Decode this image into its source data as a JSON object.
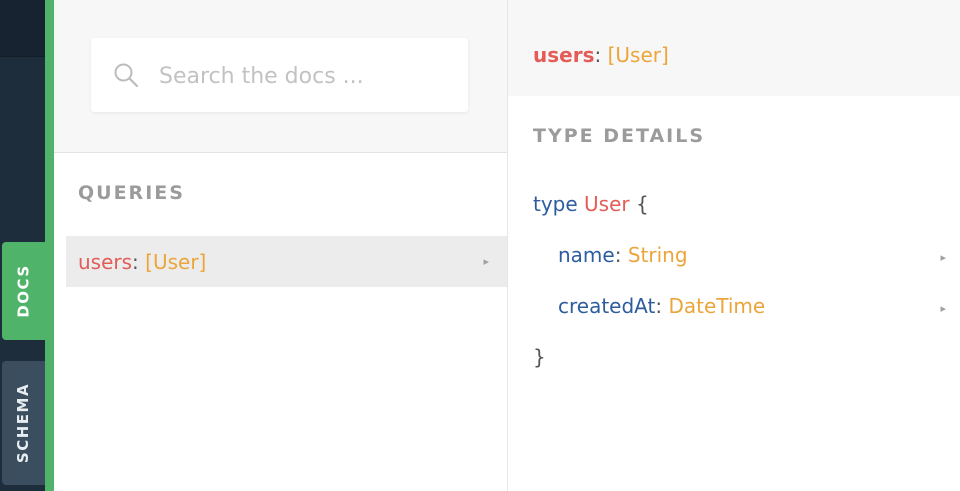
{
  "sidebar": {
    "tabs": [
      {
        "label": "DOCS",
        "active": true
      },
      {
        "label": "SCHEMA",
        "active": false
      }
    ]
  },
  "search": {
    "placeholder": "Search the docs ...",
    "value": ""
  },
  "queries": {
    "title": "QUERIES",
    "items": [
      {
        "name": "users",
        "sep": ": ",
        "type": "[User]",
        "arrow": "▸"
      }
    ]
  },
  "detail": {
    "field_name": "users",
    "field_sep": ": ",
    "field_type": "[User]",
    "section_title": "TYPE DETAILS",
    "type_keyword": "type",
    "type_name": "User",
    "open_brace": "{",
    "close_brace": "}",
    "fields": [
      {
        "name": "name",
        "sep": ": ",
        "type": "String",
        "arrow": "▸"
      },
      {
        "name": "createdAt",
        "sep": ": ",
        "type": "DateTime",
        "arrow": "▸"
      }
    ]
  },
  "colors": {
    "accent_green": "#4fb46a",
    "field_red": "#e35c57",
    "type_orange": "#eba53b",
    "keyword_blue": "#2e5d9e",
    "sidebar_dark": "#1e2d3b"
  }
}
